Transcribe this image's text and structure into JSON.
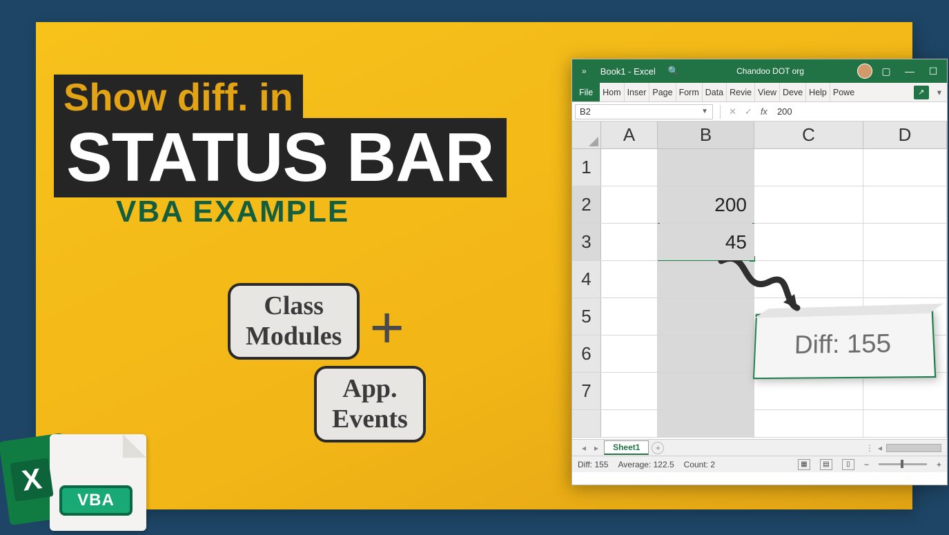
{
  "title": {
    "line1": "Show diff. in",
    "line2": "STATUS BAR",
    "line3": "VBA EXAMPLE"
  },
  "callouts": {
    "c1_l1": "Class",
    "c1_l2": "Modules",
    "plus": "+",
    "c2_l1": "App.",
    "c2_l2": "Events"
  },
  "excel": {
    "book": "Book1  -  Excel",
    "account": "Chandoo DOT org",
    "ribbon": {
      "file": "File",
      "tabs": [
        "Hom",
        "Inser",
        "Page",
        "Form",
        "Data",
        "Revie",
        "View",
        "Deve",
        "Help",
        "Powe"
      ]
    },
    "namebox": "B2",
    "formula_value": "200",
    "columns": [
      "A",
      "B",
      "C",
      "D"
    ],
    "rows": [
      "1",
      "2",
      "3",
      "4",
      "5",
      "6",
      "7"
    ],
    "cell_b2": "200",
    "cell_b3": "45",
    "sheet": "Sheet1",
    "status": {
      "diff": "Diff: 155",
      "avg": "Average: 122.5",
      "count": "Count: 2"
    }
  },
  "diff_popup": "Diff: 155",
  "logo": {
    "x": "X",
    "vba": "VBA"
  }
}
